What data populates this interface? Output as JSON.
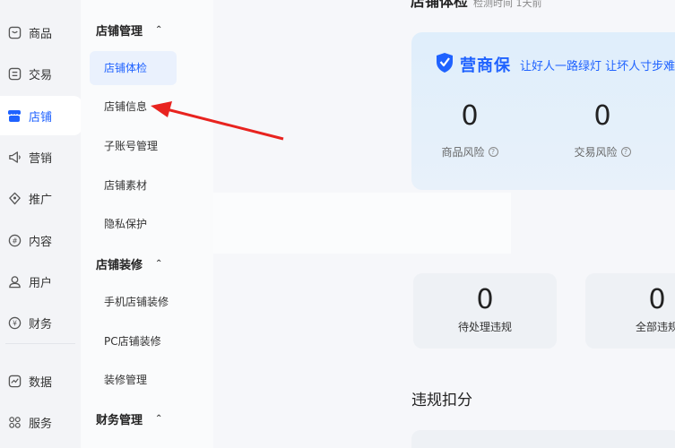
{
  "nav": {
    "items": [
      {
        "label": "商品",
        "icon": "product-icon"
      },
      {
        "label": "交易",
        "icon": "trade-icon"
      },
      {
        "label": "店铺",
        "icon": "store-icon"
      },
      {
        "label": "营销",
        "icon": "marketing-icon"
      },
      {
        "label": "推广",
        "icon": "promotion-icon"
      },
      {
        "label": "内容",
        "icon": "content-icon"
      },
      {
        "label": "用户",
        "icon": "user-icon"
      },
      {
        "label": "财务",
        "icon": "finance-icon"
      },
      {
        "label": "数据",
        "icon": "data-icon"
      },
      {
        "label": "服务",
        "icon": "service-icon"
      }
    ],
    "active": "店铺"
  },
  "submenu": {
    "groups": [
      {
        "title": "店铺管理",
        "items": [
          "店铺体检",
          "店铺信息",
          "子账号管理",
          "店铺素材",
          "隐私保护"
        ]
      },
      {
        "title": "店铺装修",
        "items": [
          "手机店铺装修",
          "PC店铺装修",
          "装修管理"
        ]
      },
      {
        "title": "财务管理",
        "items": []
      }
    ],
    "active_item": "店铺体检"
  },
  "content": {
    "page_header_partial": "店铺体检",
    "page_header_sub": "检测时间 1天前",
    "hero": {
      "brand_name": "营商保",
      "slogan": "让好人一路绿灯 让坏人寸步难",
      "metrics": [
        {
          "value": "0",
          "label": "商品风险"
        },
        {
          "value": "0",
          "label": "交易风险"
        }
      ]
    },
    "cards": [
      {
        "value": "0",
        "label": "待处理违规"
      },
      {
        "value": "0",
        "label": "全部违规"
      }
    ],
    "section_title": "违规扣分"
  },
  "colors": {
    "accent": "#1f62ff",
    "arrow": "#e8231f"
  }
}
